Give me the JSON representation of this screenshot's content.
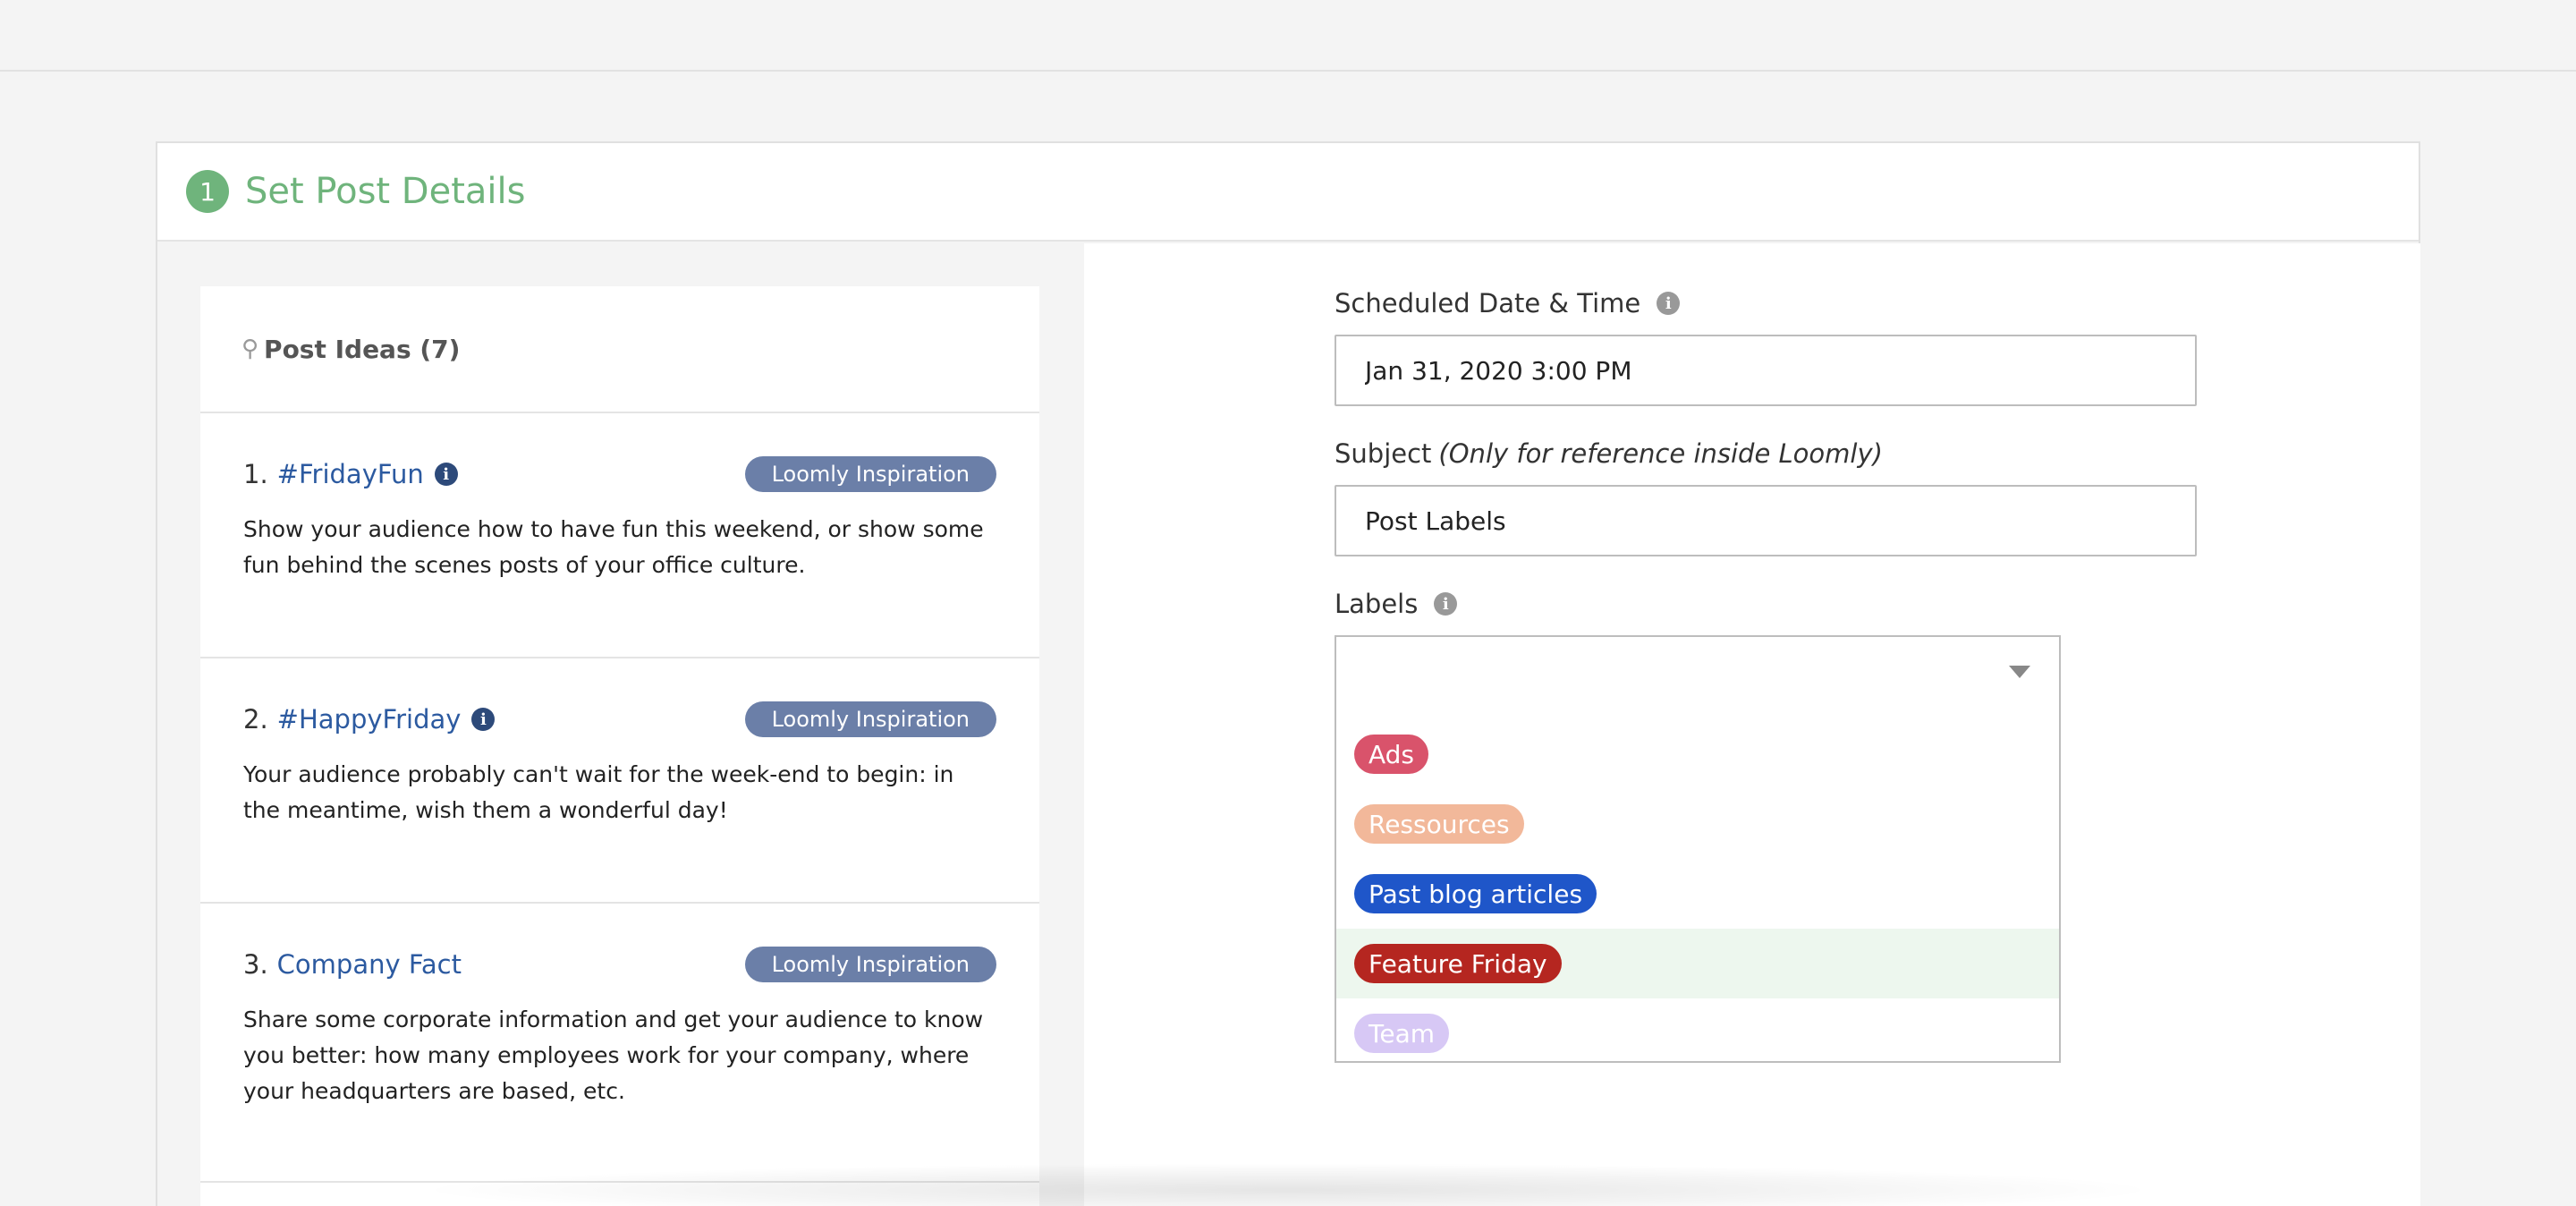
{
  "header": {
    "step_number": "1",
    "title": "Set Post Details"
  },
  "post_ideas": {
    "heading": "Post Ideas (7)",
    "items": [
      {
        "number": "1.",
        "title": "#FridayFun",
        "has_info": true,
        "tag": "Loomly Inspiration",
        "description": "Show your audience how to have fun this weekend, or show some fun behind the scenes posts of your office culture."
      },
      {
        "number": "2.",
        "title": "#HappyFriday",
        "has_info": true,
        "tag": "Loomly Inspiration",
        "description": "Your audience probably can't wait for the week-end to begin: in the meantime, wish them a wonderful day!"
      },
      {
        "number": "3.",
        "title": "Company Fact",
        "has_info": false,
        "tag": "Loomly Inspiration",
        "description": "Share some corporate information and get your audience to know you better: how many employees work for your company, where your headquarters are based, etc."
      }
    ]
  },
  "form": {
    "scheduled_label": "Scheduled Date & Time",
    "scheduled_value": "Jan 31, 2020 3:00 PM",
    "subject_label": "Subject",
    "subject_hint": "(Only for reference inside Loomly)",
    "subject_value": "Post Labels",
    "labels_label": "Labels",
    "labels_value": ""
  },
  "label_options": [
    {
      "name": "Ads",
      "color": "#d9536b"
    },
    {
      "name": "Ressources",
      "color": "#f2b89a"
    },
    {
      "name": "Past blog articles",
      "color": "#1f56c9"
    },
    {
      "name": "Feature Friday",
      "color": "#b52620",
      "highlighted": true
    },
    {
      "name": "Team",
      "color": "#d7c8f5"
    }
  ],
  "icons": {
    "info": "info-icon",
    "bulb": "lightbulb-icon",
    "caret": "chevron-down-icon"
  },
  "colors": {
    "accent_green": "#6fb47c",
    "link_blue": "#2c5aa0",
    "tag_bg": "#6b7fa8"
  }
}
